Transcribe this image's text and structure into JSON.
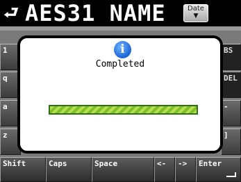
{
  "header": {
    "back_icon": "back-arrow-icon",
    "title": "AES31 NAME",
    "date_button_label": "Date"
  },
  "keyboard": {
    "left_keys": [
      "1",
      "q",
      "a",
      "z"
    ],
    "right_keys": [
      "BS",
      "DEL",
      "-",
      "]"
    ],
    "bottom_keys": [
      "Shift",
      "Caps",
      "Space",
      "<-",
      "->",
      "Enter"
    ]
  },
  "dialog": {
    "icon": "info-icon",
    "icon_glyph": "i",
    "message": "Completed",
    "progress": 1.0,
    "progress_color": "#8fd13a"
  }
}
